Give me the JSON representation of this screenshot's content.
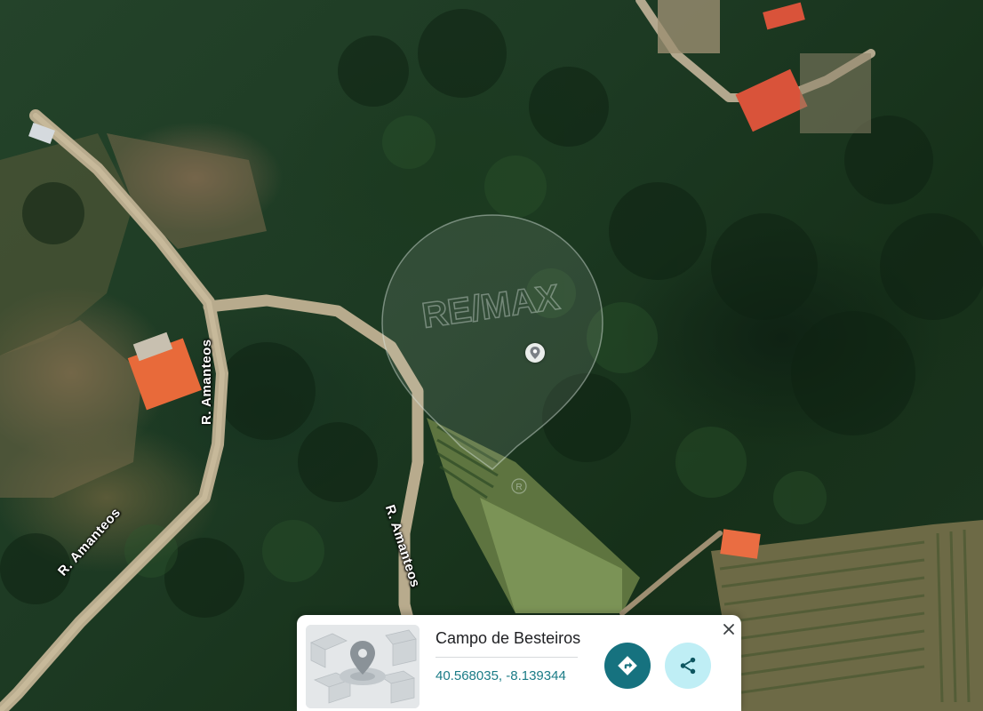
{
  "map": {
    "road_labels": [
      "R. Amanteos",
      "R. Amanteos",
      "R. Amanteos"
    ],
    "watermark_text": "RE/MAX"
  },
  "info_card": {
    "place_name": "Campo de Besteiros",
    "coordinates": "40.568035, -8.139344",
    "thumbnail_icon": "map-pin-3d-icon",
    "directions_icon": "directions-icon",
    "share_icon": "share-icon",
    "close_icon": "close-icon"
  },
  "colors": {
    "accent_teal": "#16727f",
    "share_bg": "#bfeef5",
    "coord_text": "#1a7b86"
  }
}
